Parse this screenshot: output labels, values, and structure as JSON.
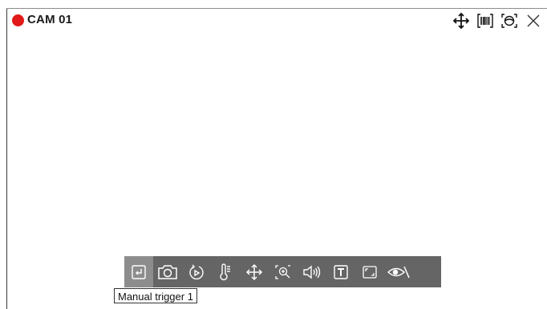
{
  "camera": {
    "title": "CAM 01",
    "recording_color": "#e11919"
  },
  "top_controls": [
    {
      "icon": "move-icon"
    },
    {
      "icon": "barcode-scan-icon"
    },
    {
      "icon": "fisheye-view-icon"
    },
    {
      "icon": "close-icon"
    }
  ],
  "toolbar": {
    "background": "#656565",
    "active_index": 0,
    "buttons": [
      {
        "icon": "manual-trigger-icon"
      },
      {
        "icon": "camera-snapshot-icon"
      },
      {
        "icon": "instant-replay-icon"
      },
      {
        "icon": "temperature-icon"
      },
      {
        "icon": "ptz-move-icon"
      },
      {
        "icon": "digital-zoom-icon"
      },
      {
        "icon": "audio-icon"
      },
      {
        "icon": "text-overlay-icon"
      },
      {
        "icon": "aspect-ratio-icon"
      },
      {
        "icon": "privacy-view-icon"
      }
    ]
  },
  "tooltip": {
    "text": "Manual trigger 1"
  }
}
